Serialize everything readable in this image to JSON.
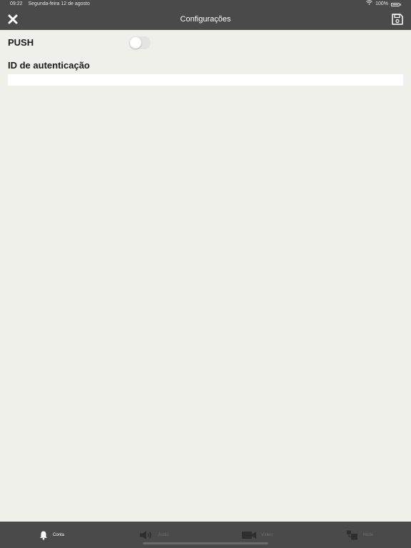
{
  "status_bar": {
    "time": "09:22",
    "date": "Segunda-feira 12 de agosto",
    "battery_percent": "100%",
    "wifi_icon": "wifi-icon",
    "battery_icon": "battery-icon"
  },
  "nav": {
    "title": "Configurações",
    "close_icon": "close-icon",
    "save_icon": "save-icon"
  },
  "settings": {
    "push_label": "PUSH",
    "push_enabled": false,
    "auth_label": "ID de autenticação",
    "auth_value": "",
    "auth_placeholder": ""
  },
  "tabs": [
    {
      "label": "Conta",
      "icon": "bell-icon",
      "active": true
    },
    {
      "label": "Áudio",
      "icon": "speaker-icon",
      "active": false
    },
    {
      "label": "Vídeo",
      "icon": "video-camera-icon",
      "active": false
    },
    {
      "label": "Rede",
      "icon": "network-icon",
      "active": false
    }
  ],
  "colors": {
    "bar_background": "#4a4a4a",
    "content_background": "#f0f0eb",
    "active_tab_text": "#ffffff",
    "inactive_tab_text": "#6e6e6e"
  }
}
